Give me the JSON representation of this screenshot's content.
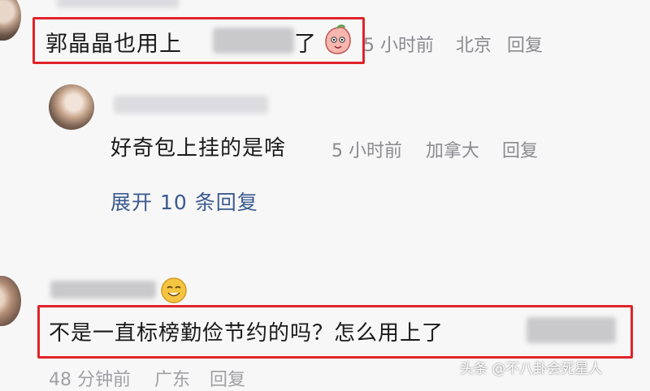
{
  "comment_1": {
    "text": "郭晶晶也用上",
    "text_suffix": "了",
    "time": "5 小时前",
    "location": "北京",
    "reply_label": "回复"
  },
  "reply_1": {
    "text": "好奇包上挂的是啥",
    "time": "5 小时前",
    "location": "加拿大",
    "reply_label": "回复"
  },
  "expand_replies": {
    "label": "展开 10 条回复"
  },
  "comment_2": {
    "text": "不是一直标榜勤俭节约的吗？怎么用上了",
    "time": "48 分钟前",
    "location": "广东",
    "reply_label": "回复"
  },
  "watermark": {
    "text": "头条 @不八卦会死星人"
  },
  "colors": {
    "highlight_border": "#e0242a",
    "link": "#3b5a8f",
    "meta": "#8a8a8f",
    "background": "#f7f7f7"
  }
}
